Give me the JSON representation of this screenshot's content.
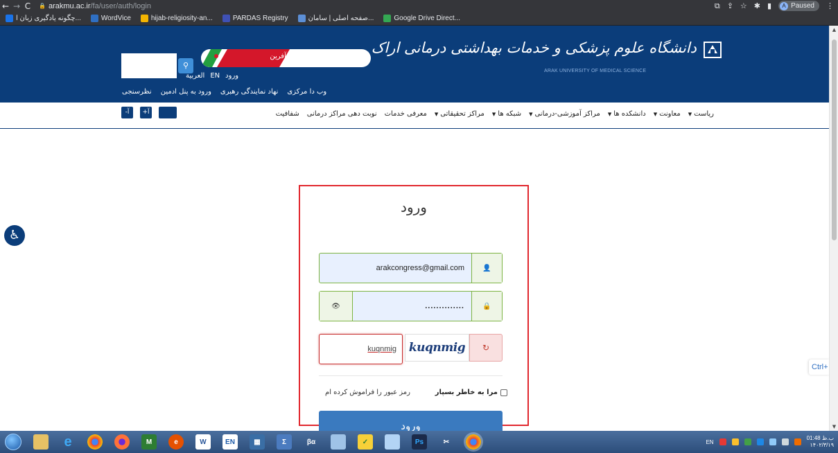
{
  "browser": {
    "url_domain": "arakmu.ac.ir",
    "url_path": "/fa/user/auth/login",
    "profile_initial": "A",
    "profile_status": "Paused",
    "bookmarks": [
      {
        "label": "چگونه یادگیری زبان ا...",
        "color": "#1a73e8"
      },
      {
        "label": "WordVice",
        "color": "#2f6fc2"
      },
      {
        "label": "hijab-religiosity-an...",
        "color": "#f4b400"
      },
      {
        "label": "PARDAS Registry",
        "color": "#3f51b5"
      },
      {
        "label": "صفحه اصلی | سامان...",
        "color": "#5c8fd6"
      },
      {
        "label": "Google Drive Direct...",
        "color": "#34a853"
      }
    ]
  },
  "site": {
    "logo_title": "دانشگاه علوم پزشکی و خدمات بهداشتی درمانی اراک",
    "logo_subtitle": "ARAK UNIVERSITY OF MEDICAL SCIENCE",
    "slogan": "تولید، دانش‌بنیان و اشتغال‌آفرین",
    "lang_links": [
      "ورود",
      "EN",
      "العربية"
    ],
    "top_links": [
      "وب دا مرکزی",
      "نهاد نمایندگی رهبری",
      "ورود به پنل ادمین",
      "نظرسنجی"
    ],
    "menu": [
      {
        "label": "ریاست",
        "dropdown": true
      },
      {
        "label": "معاونت",
        "dropdown": true
      },
      {
        "label": "دانشکده ها",
        "dropdown": true
      },
      {
        "label": "مراکز آموزشی-درمانی",
        "dropdown": true
      },
      {
        "label": "شبکه ها",
        "dropdown": true
      },
      {
        "label": "مراکز تحقیقاتی",
        "dropdown": true
      },
      {
        "label": "معرفی خدمات",
        "dropdown": false
      },
      {
        "label": "نوبت دهی مراکز درمانی",
        "dropdown": false
      },
      {
        "label": "شفافیت",
        "dropdown": false
      }
    ],
    "font_buttons": [
      "-آ",
      "+آ"
    ],
    "ctrl_badge": "Ctrl+"
  },
  "login": {
    "title": "ورود",
    "email_value": "arakcongress@gmail.com",
    "password_value": "..............",
    "captcha_image_text": "kuqnmig",
    "captcha_value": "kuqnmig",
    "remember_label": "مرا به خاطر بسپار",
    "forgot_label": "رمز عبور را فراموش کرده ام",
    "submit_label": "ورود"
  },
  "taskbar": {
    "lang": "EN",
    "time": "01:48 ب.ظ",
    "date": "۱۴۰۲/۳/۱۹"
  },
  "colors": {
    "header_blue": "#0b3d7a",
    "highlight_red": "#e1262d",
    "submit_blue": "#3a7abf",
    "field_green": "#7cb342"
  }
}
